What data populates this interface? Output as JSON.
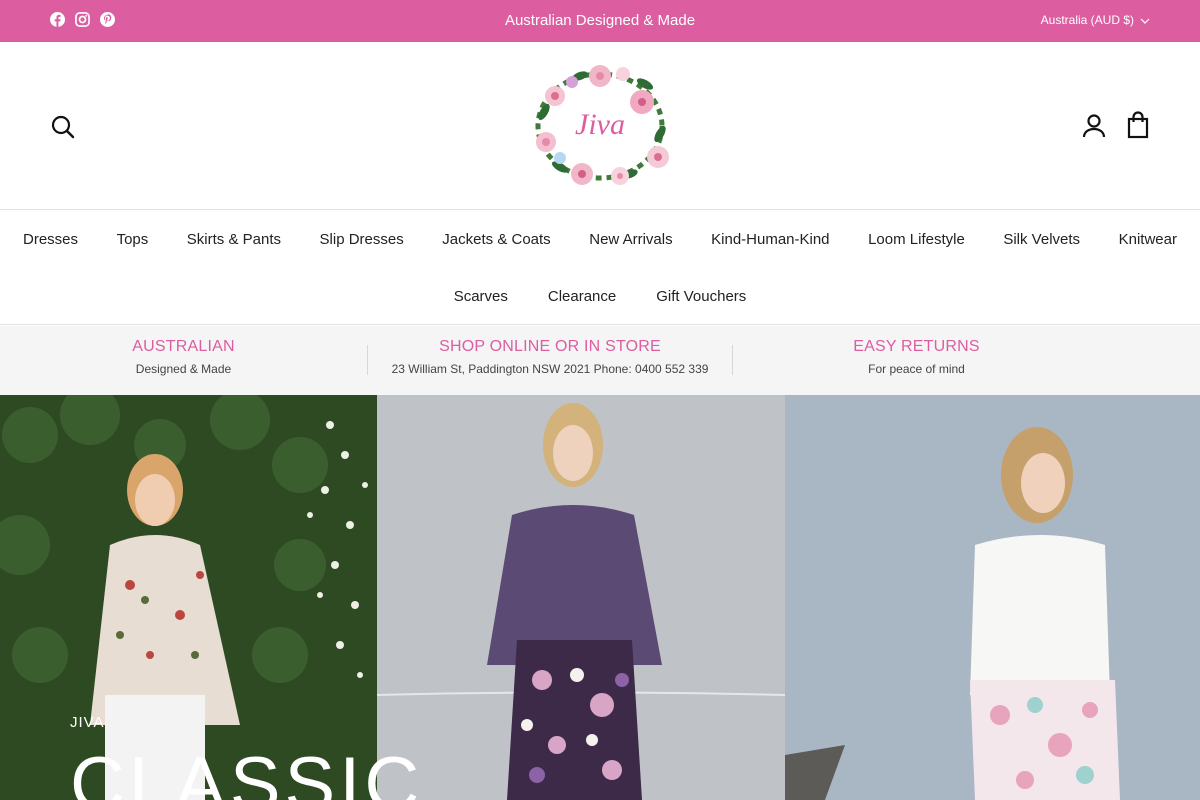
{
  "announcement": {
    "message": "Australian Designed & Made",
    "locale": "Australia (AUD $)",
    "social": [
      "facebook-icon",
      "instagram-icon",
      "pinterest-icon"
    ]
  },
  "header": {
    "logo_text": "Jiva"
  },
  "nav": {
    "row1": [
      "Dresses",
      "Tops",
      "Skirts & Pants",
      "Slip Dresses",
      "Jackets & Coats",
      "New Arrivals",
      "Kind-Human-Kind",
      "Loom Lifestyle",
      "Silk Velvets",
      "Knitwear"
    ],
    "row2": [
      "Scarves",
      "Clearance",
      "Gift Vouchers"
    ]
  },
  "usp": [
    {
      "title": "AUSTRALIAN",
      "subtitle": "Designed & Made"
    },
    {
      "title": "SHOP ONLINE OR IN STORE",
      "subtitle": "23 William St, Paddington NSW 2021 Phone: 0400 552 339"
    },
    {
      "title": "EASY RETURNS",
      "subtitle": "For peace of mind"
    }
  ],
  "hero": {
    "kicker": "JIVA",
    "title": "CLASSIC"
  },
  "colors": {
    "brand_pink": "#dc5da0",
    "usp_bg": "#f5f5f6"
  }
}
